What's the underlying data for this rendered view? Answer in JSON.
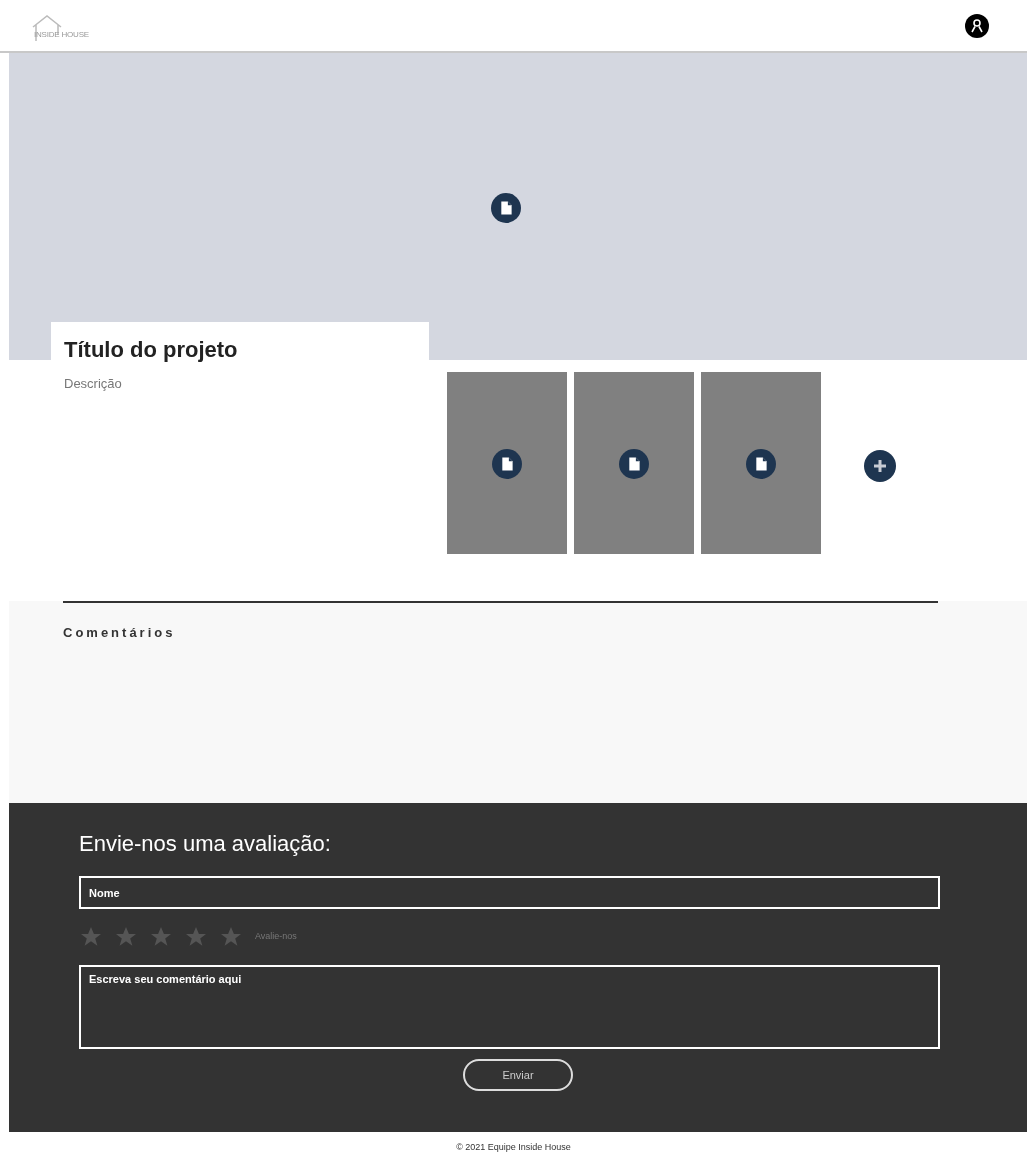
{
  "header": {
    "logo_text": "INSIDE HOUSE"
  },
  "project": {
    "title": "Título do projeto",
    "description": "Descrição"
  },
  "comments": {
    "heading": "Comentários"
  },
  "review_form": {
    "heading": "Envie-nos uma avaliação:",
    "name_field": {
      "placeholder": "Nome"
    },
    "stars": 0,
    "rating_label": "Avalie-nos",
    "comment_field": {
      "placeholder": "Escreva seu comentário aqui"
    },
    "submit": "Enviar"
  },
  "footer": {
    "copyright": "© 2021 Equipe Inside House"
  }
}
